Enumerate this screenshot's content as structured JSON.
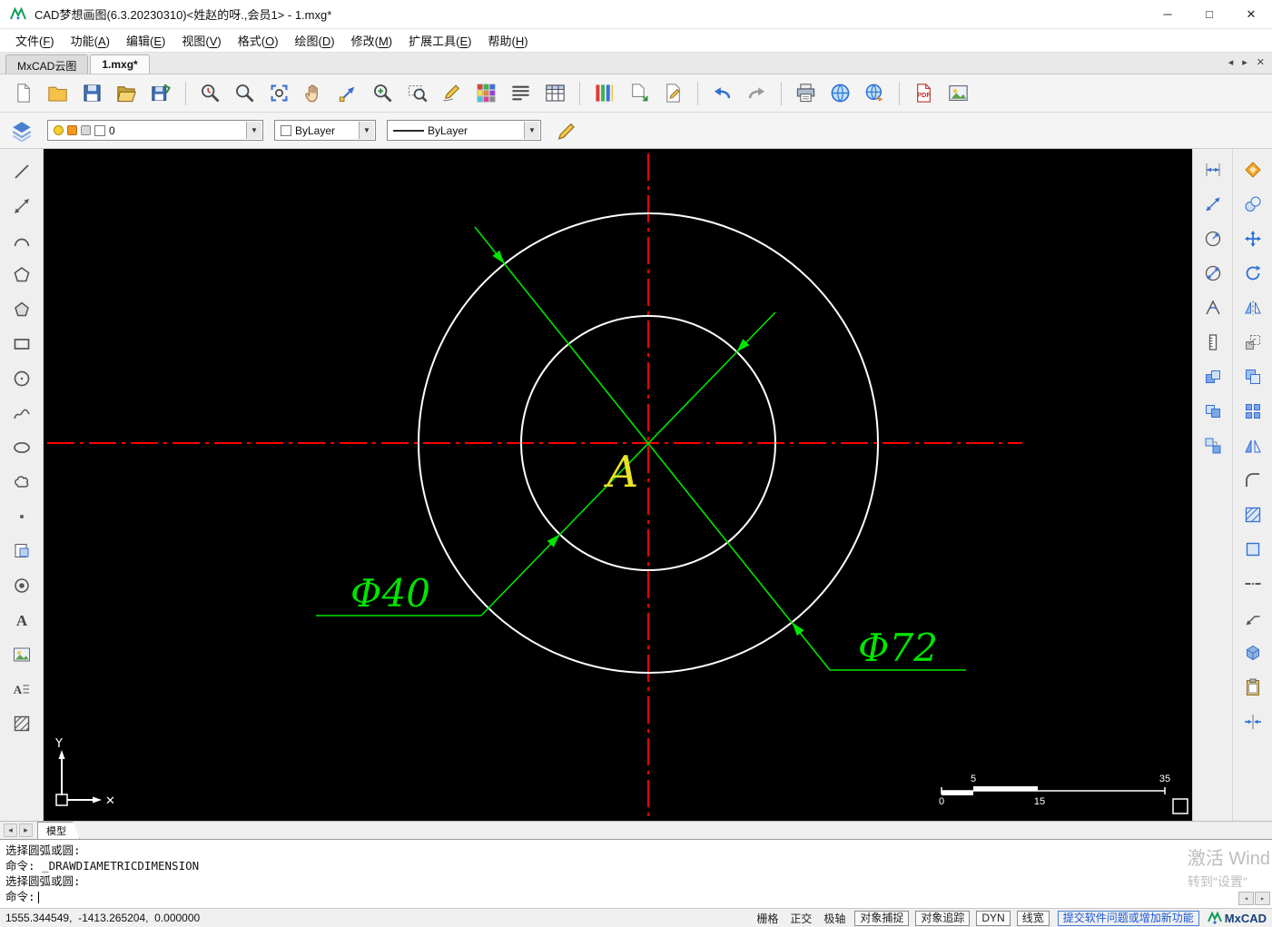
{
  "window": {
    "title": "CAD梦想画图(6.3.20230310)<姓赵的呀.,会员1> - 1.mxg*",
    "controls": {
      "minimize": "─",
      "maximize": "□",
      "close": "✕"
    }
  },
  "menu": {
    "items": [
      {
        "name": "menu-file",
        "label": "文件(F)"
      },
      {
        "name": "menu-function",
        "label": "功能(A)"
      },
      {
        "name": "menu-edit",
        "label": "编辑(E)"
      },
      {
        "name": "menu-view",
        "label": "视图(V)"
      },
      {
        "name": "menu-format",
        "label": "格式(O)"
      },
      {
        "name": "menu-draw",
        "label": "绘图(D)"
      },
      {
        "name": "menu-modify",
        "label": "修改(M)"
      },
      {
        "name": "menu-ext-tools",
        "label": "扩展工具(E)"
      },
      {
        "name": "menu-help",
        "label": "帮助(H)"
      }
    ]
  },
  "tabs": {
    "items": [
      {
        "name": "tab-mxcad-cloud",
        "label": "MxCAD云图",
        "active": false
      },
      {
        "name": "tab-1mxg",
        "label": "1.mxg*",
        "active": true
      }
    ],
    "nav": {
      "prev": "◂",
      "next": "▸",
      "close": "✕"
    }
  },
  "toolbar": {
    "buttons": [
      {
        "name": "new-file-button",
        "icon": "page"
      },
      {
        "name": "open-file-button",
        "icon": "folder"
      },
      {
        "name": "save-button",
        "icon": "floppy"
      },
      {
        "name": "open-folder-button",
        "icon": "folderOpen"
      },
      {
        "name": "save-as-button",
        "icon": "floppySave"
      },
      {
        "sep": true
      },
      {
        "name": "zoom-previous-button",
        "icon": "magClock"
      },
      {
        "name": "zoom-window-button",
        "icon": "mag"
      },
      {
        "name": "zoom-extents-button",
        "icon": "zoomExtents"
      },
      {
        "name": "pan-button",
        "icon": "hand"
      },
      {
        "name": "zoom-scale-button",
        "icon": "diagArrow"
      },
      {
        "name": "zoom-realtime-button",
        "icon": "magPlus"
      },
      {
        "name": "zoom-object-button",
        "icon": "magRect"
      },
      {
        "name": "sketch-button",
        "icon": "pencilSign"
      },
      {
        "name": "color-palette-button",
        "icon": "palette"
      },
      {
        "name": "text-style-button",
        "icon": "textLines"
      },
      {
        "name": "layer-manager-button",
        "icon": "layersTable"
      },
      {
        "sep": true
      },
      {
        "name": "draw-order-button",
        "icon": "colorBars"
      },
      {
        "name": "export-button",
        "icon": "exportArrow"
      },
      {
        "name": "options-button",
        "icon": "pagePencil"
      },
      {
        "sep": true
      },
      {
        "name": "undo-button",
        "icon": "undo"
      },
      {
        "name": "redo-button",
        "icon": "redo"
      },
      {
        "sep": true
      },
      {
        "name": "print-button",
        "icon": "printer"
      },
      {
        "name": "web-button",
        "icon": "globe"
      },
      {
        "name": "publish-button",
        "icon": "globeArrow"
      },
      {
        "sep": true
      },
      {
        "name": "pdf-export-button",
        "icon": "pdf"
      },
      {
        "name": "image-export-button",
        "icon": "imagePic"
      }
    ]
  },
  "properties": {
    "layer": {
      "value": "0"
    },
    "color": {
      "value": "ByLayer"
    },
    "linetype": {
      "value": "ByLayer"
    }
  },
  "left_toolbar": {
    "buttons": [
      {
        "name": "draw-line-button",
        "icon": "line"
      },
      {
        "name": "draw-xline-button",
        "icon": "xline"
      },
      {
        "name": "draw-arc-button",
        "icon": "arcTool"
      },
      {
        "name": "draw-polyline-button",
        "icon": "polygon"
      },
      {
        "name": "draw-polygon-button",
        "icon": "pentagon"
      },
      {
        "name": "draw-rectangle-button",
        "icon": "rectTool"
      },
      {
        "name": "draw-circle-button",
        "icon": "circleTool"
      },
      {
        "name": "draw-spline-button",
        "icon": "spline"
      },
      {
        "name": "draw-ellipse-button",
        "icon": "ellipseTool"
      },
      {
        "name": "draw-revcloud-button",
        "icon": "cloud"
      },
      {
        "name": "draw-point-button",
        "icon": "point"
      },
      {
        "name": "insert-block-button",
        "icon": "block"
      },
      {
        "name": "draw-donut-button",
        "icon": "donut"
      },
      {
        "name": "draw-text-button",
        "icon": "textA"
      },
      {
        "name": "insert-image-button",
        "icon": "imagePic"
      },
      {
        "name": "draw-mtext-button",
        "icon": "mtext"
      },
      {
        "name": "draw-hatch-button",
        "icon": "hatch"
      }
    ]
  },
  "right_toolbar": {
    "inner": [
      {
        "name": "dim-linear-button",
        "icon": "dimLinear"
      },
      {
        "name": "dim-aligned-button",
        "icon": "dimAligned"
      },
      {
        "name": "dim-radius-button",
        "icon": "dimRadius"
      },
      {
        "name": "dim-diameter-button",
        "icon": "dimDiameter"
      },
      {
        "name": "dim-angular-button",
        "icon": "dimAngular"
      },
      {
        "name": "dim-ordinate-button",
        "icon": "dimOrdinate"
      },
      {
        "name": "dim-baseline-button",
        "icon": "blueSquares"
      },
      {
        "name": "dim-continue-button",
        "icon": "blueSquares2"
      },
      {
        "name": "dim-quick-button",
        "icon": "blueSquares3"
      }
    ],
    "outer": [
      {
        "name": "modify-erase-button",
        "icon": "erase"
      },
      {
        "name": "modify-copy-button",
        "icon": "copyTool"
      },
      {
        "name": "modify-move-button",
        "icon": "move"
      },
      {
        "name": "modify-rotate-button",
        "icon": "rotateTool"
      },
      {
        "name": "modify-mirror-button",
        "icon": "mirrorTool"
      },
      {
        "name": "modify-scale-button",
        "icon": "scaleTool"
      },
      {
        "name": "modify-offset-button",
        "icon": "offsetTool"
      },
      {
        "name": "modify-array-button",
        "icon": "arrayTool"
      },
      {
        "name": "modify-align-button",
        "icon": "mirrorTri"
      },
      {
        "name": "modify-fillet-button",
        "icon": "fillet"
      },
      {
        "name": "modify-hatch-edit-button",
        "icon": "hatchBlue"
      },
      {
        "name": "modify-region-button",
        "icon": "region"
      },
      {
        "name": "modify-linetype-button",
        "icon": "dashdot"
      },
      {
        "name": "modify-leader-button",
        "icon": "leader"
      },
      {
        "name": "modify-extrude-button",
        "icon": "box3d"
      },
      {
        "name": "modify-paste-button",
        "icon": "clipboard"
      },
      {
        "name": "modify-trim-button",
        "icon": "converge"
      }
    ]
  },
  "canvas": {
    "background": "#000000",
    "centerline_color": "#ff0000",
    "geometry_color": "#ffffff",
    "dimension_color": "#00e400",
    "label_color": "#e8e228",
    "dim_inner_label": "Φ40",
    "dim_outer_label": "Φ72",
    "point_label": "A",
    "ucs": {
      "x_label": "✕",
      "y_label": "Y"
    },
    "scale_bar": {
      "top": [
        "5",
        "35"
      ],
      "bottom": [
        "0",
        "15"
      ]
    }
  },
  "model_bar": {
    "prev": "◂",
    "next": "▸",
    "tab_label": "模型"
  },
  "command": {
    "lines": [
      {
        "text": "选择圆弧或圆:"
      },
      {
        "text": "命令: _DRAWDIAMETRICDIMENSION"
      },
      {
        "text": "选择圆弧或圆:"
      },
      {
        "text": "命令:",
        "cursor": true
      }
    ],
    "watermark": [
      "激活 Wind",
      "转到\"设置\""
    ],
    "scroll": {
      "left": "◂",
      "right": "▸"
    }
  },
  "status": {
    "coordinates": "1555.344549,  -1413.265204,  0.000000",
    "toggles": [
      {
        "name": "status-toggle-grid",
        "label": "栅格",
        "boxed": false
      },
      {
        "name": "status-toggle-ortho",
        "label": "正交",
        "boxed": false
      },
      {
        "name": "status-toggle-polar",
        "label": "极轴",
        "boxed": false
      },
      {
        "name": "status-toggle-osnap",
        "label": "对象捕捉",
        "boxed": true
      },
      {
        "name": "status-toggle-otrack",
        "label": "对象追踪",
        "boxed": true
      },
      {
        "name": "status-toggle-dyn",
        "label": "DYN",
        "boxed": true
      },
      {
        "name": "status-toggle-lineweight",
        "label": "线宽",
        "boxed": true
      }
    ],
    "link": "提交软件问题或增加新功能",
    "brand": "MxCAD"
  }
}
